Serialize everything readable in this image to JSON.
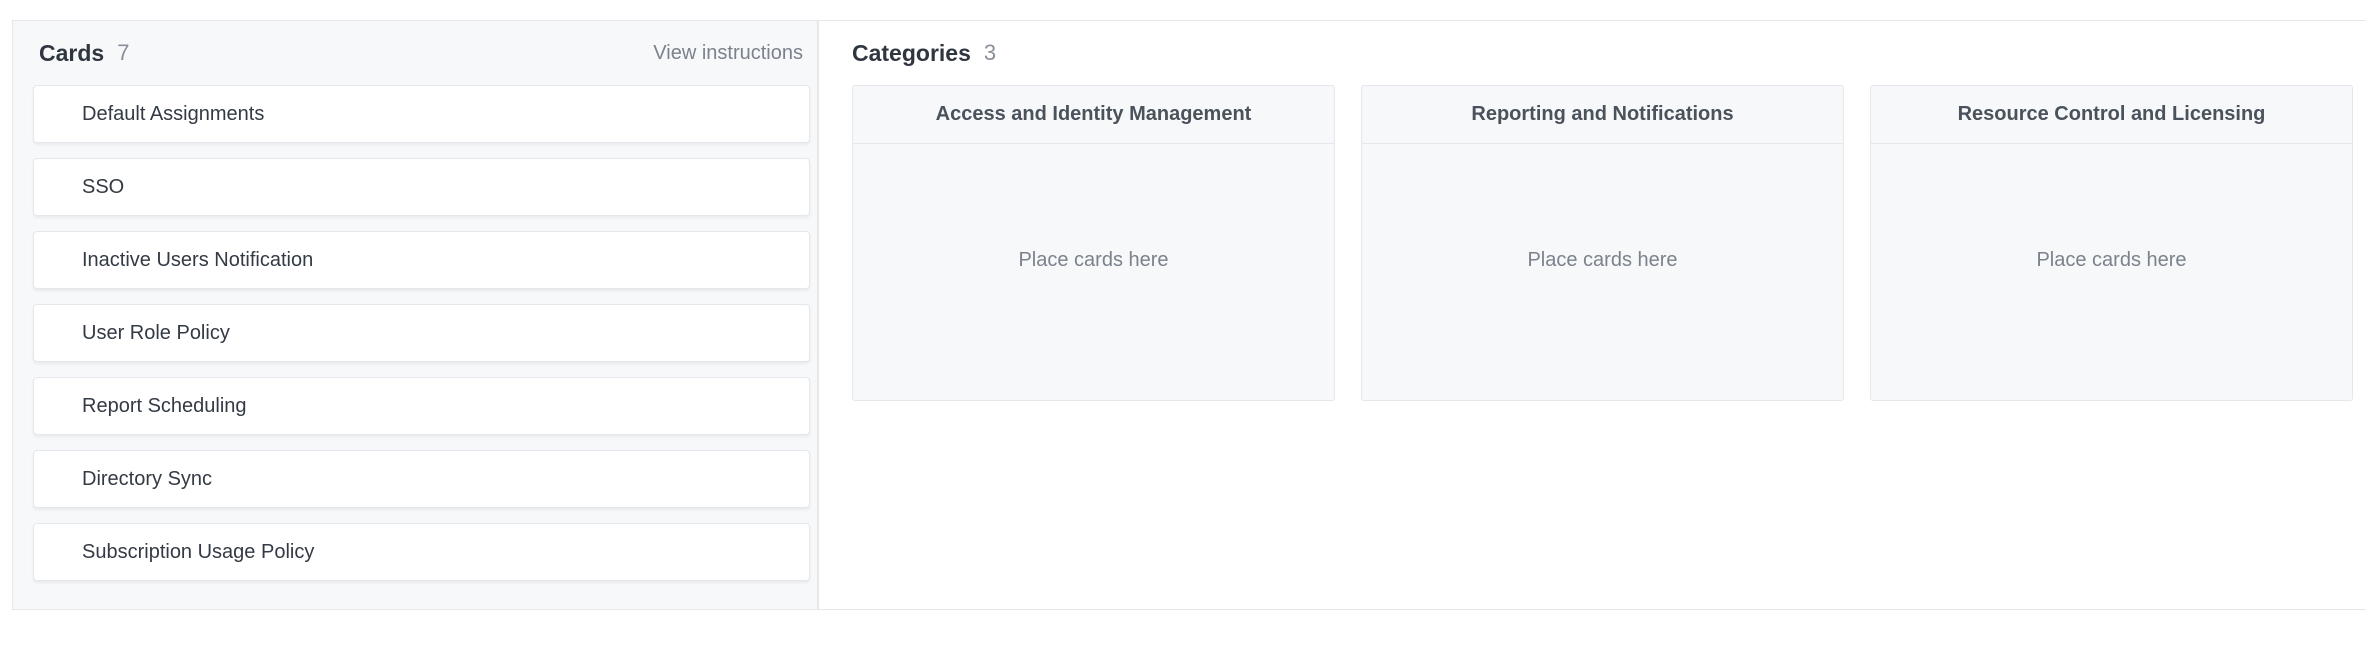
{
  "cards_panel": {
    "title": "Cards",
    "count": "7",
    "view_instructions_label": "View instructions",
    "cards": [
      {
        "label": "Default Assignments"
      },
      {
        "label": "SSO"
      },
      {
        "label": "Inactive Users Notification"
      },
      {
        "label": "User Role Policy"
      },
      {
        "label": "Report Scheduling"
      },
      {
        "label": "Directory Sync"
      },
      {
        "label": "Subscription Usage Policy"
      }
    ]
  },
  "categories_panel": {
    "title": "Categories",
    "count": "3",
    "categories": [
      {
        "name": "Access and Identity Management",
        "placeholder": "Place cards here"
      },
      {
        "name": "Reporting and Notifications",
        "placeholder": "Place cards here"
      },
      {
        "name": "Resource Control and Licensing",
        "placeholder": "Place cards here"
      }
    ]
  }
}
